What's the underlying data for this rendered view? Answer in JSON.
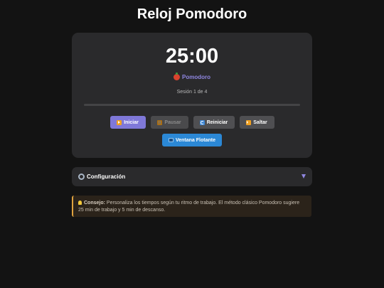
{
  "page": {
    "title": "Reloj Pomodoro"
  },
  "timer": {
    "time": "25:00",
    "mode_label": "Pomodoro",
    "mode_icon": "tomato-icon",
    "session_text": "Sesión 1 de 4",
    "progress_percent": 0
  },
  "controls": {
    "start_label": "Iniciar",
    "pause_label": "Pausar",
    "reset_label": "Reiniciar",
    "skip_label": "Saltar",
    "floating_label": "Ventana Flotante"
  },
  "config": {
    "label": "Configuración",
    "expanded": false
  },
  "tip": {
    "prefix": "Consejo:",
    "text": "Personaliza los tiempos según tu ritmo de trabajo. El método clásico Pomodoro sugiere 25 min de trabajo y 5 min de descanso."
  },
  "colors": {
    "accent": "#8f86e0",
    "background": "#131313",
    "card": "#2a2a2c",
    "float_button": "#2b88d6",
    "tip_border": "#e0a33e"
  }
}
